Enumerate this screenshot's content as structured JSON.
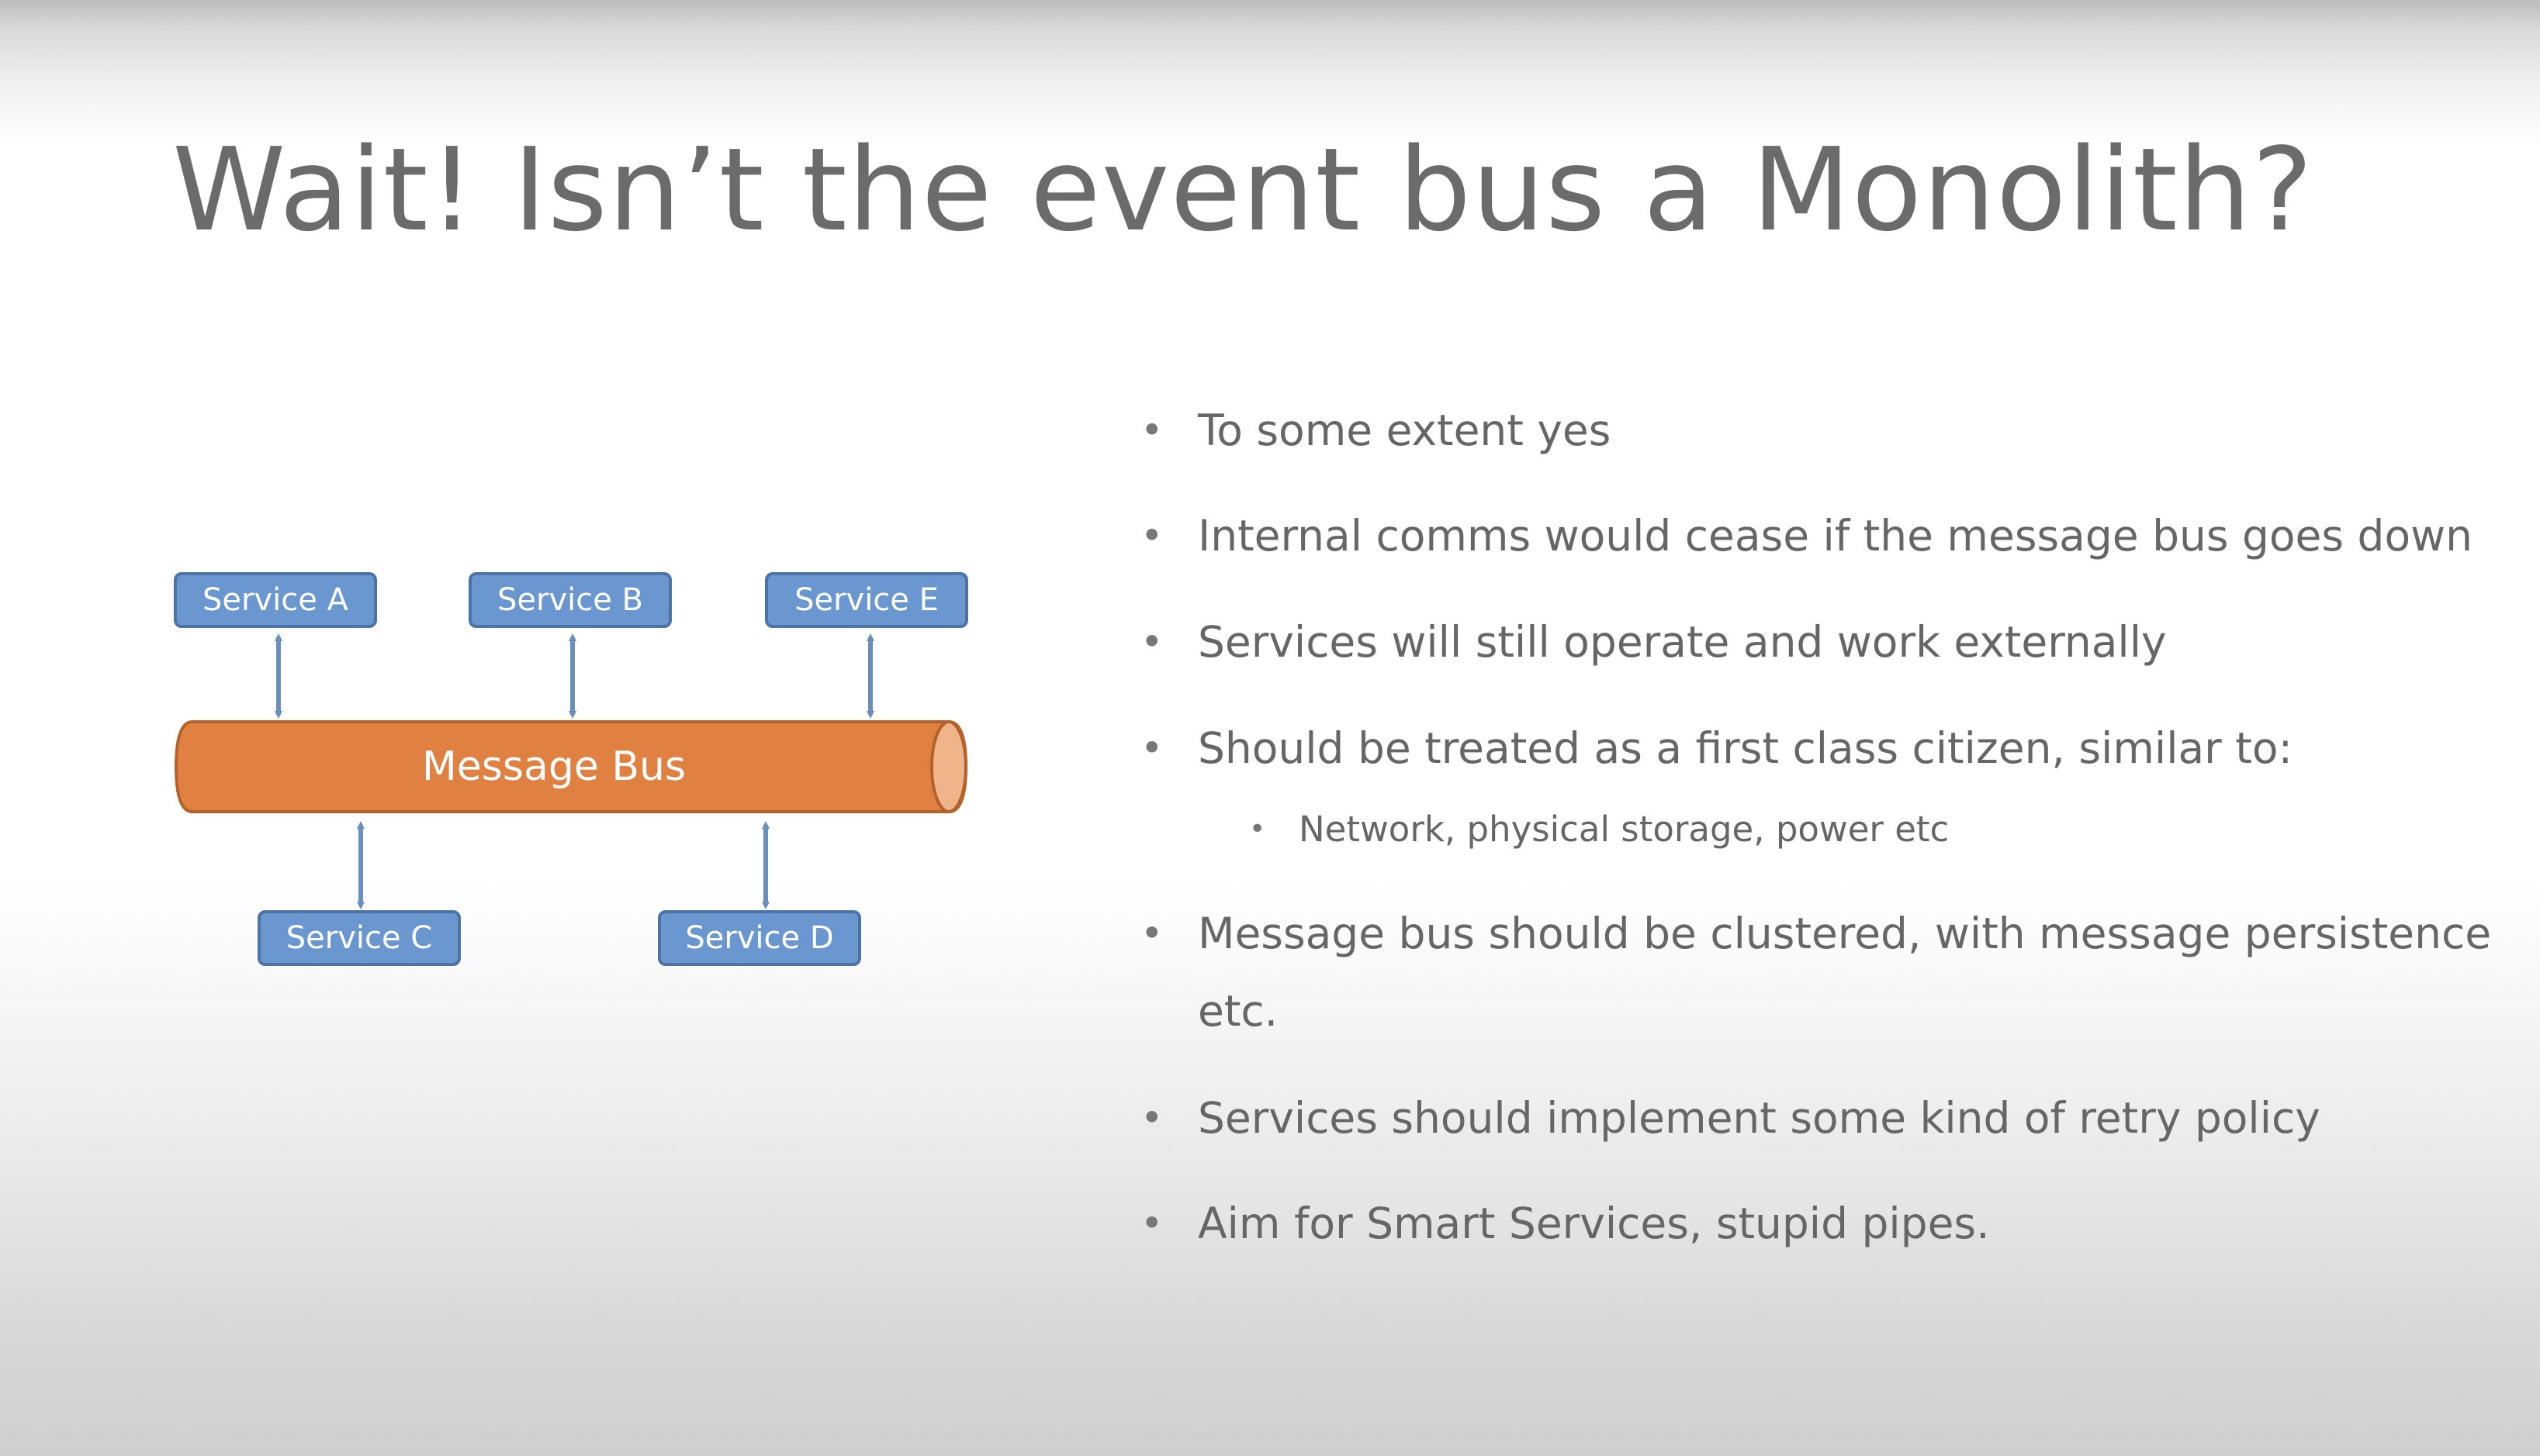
{
  "slide": {
    "title": "Wait! Isn’t the event bus a Monolith?"
  },
  "diagram": {
    "bus_label": "Message Bus",
    "services": {
      "a": "Service A",
      "b": "Service B",
      "e": "Service E",
      "c": "Service C",
      "d": "Service D"
    },
    "colors": {
      "service_fill": "#6a97cf",
      "service_border": "#4c73a6",
      "bus_fill": "#e08141",
      "bus_border": "#b5612a",
      "bus_cap": "#f0b48b",
      "arrow": "#6a8fbd"
    }
  },
  "bullets": [
    {
      "marker": "•",
      "text": "To some extent yes"
    },
    {
      "marker": "•",
      "text": "Internal comms would cease if the message bus goes down"
    },
    {
      "marker": "•",
      "text": "Services will still operate and work externally"
    },
    {
      "marker": "•",
      "text": "Should be treated as a first class citizen, similar to:",
      "sub": [
        {
          "marker": "•",
          "text": "Network, physical storage, power etc"
        }
      ]
    },
    {
      "marker": "•",
      "text": "Message bus should be clustered, with message persistence etc."
    },
    {
      "marker": "•",
      "text": "Services should implement some kind of retry policy"
    },
    {
      "marker": "•",
      "text": "Aim for Smart Services, stupid pipes."
    }
  ]
}
